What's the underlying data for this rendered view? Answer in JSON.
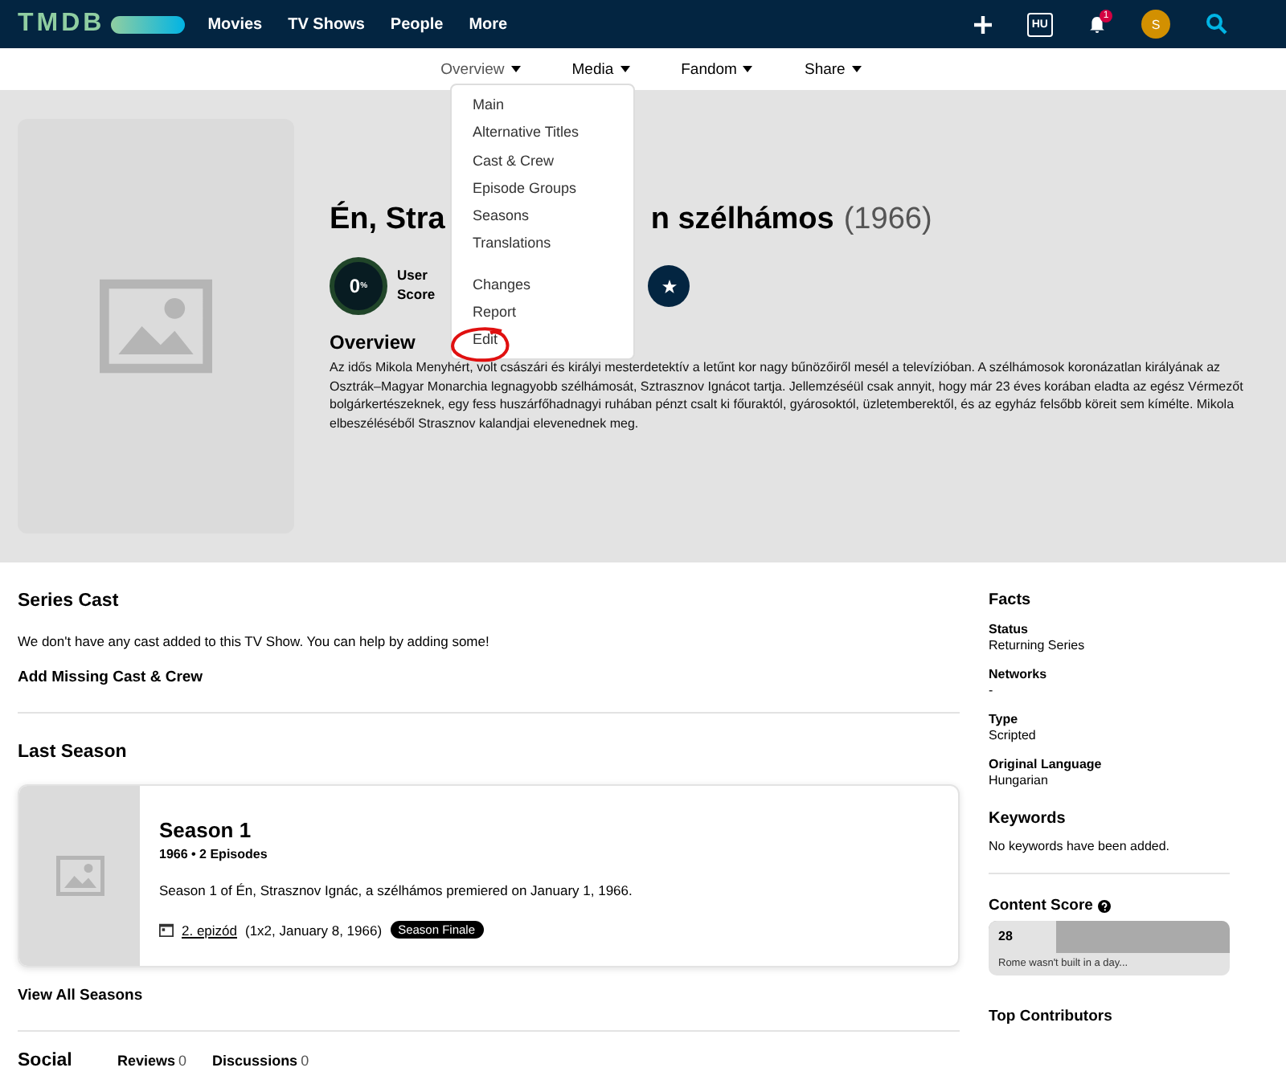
{
  "header": {
    "logo": "TMDB",
    "nav": [
      "Movies",
      "TV Shows",
      "People",
      "More"
    ],
    "language": "HU",
    "notifications": "1",
    "avatar": "S"
  },
  "subnav": [
    {
      "label": "Overview",
      "selected": true
    },
    {
      "label": "Media",
      "selected": false
    },
    {
      "label": "Fandom",
      "selected": false
    },
    {
      "label": "Share",
      "selected": false
    }
  ],
  "dropdown": {
    "groups": [
      [
        "Main",
        "Alternative Titles",
        "Cast & Crew",
        "Episode Groups",
        "Seasons",
        "Translations"
      ],
      [
        "Changes",
        "Report",
        "Edit"
      ]
    ]
  },
  "hero": {
    "title_visible_start": "Én, Stra",
    "title_visible_end": "n szélhámos",
    "year": "(1966)",
    "score": "0",
    "score_unit": "%",
    "score_label": "User Score",
    "overview_heading": "Overview",
    "overview": "Az idős Mikola Menyhért, volt császári és királyi mesterdetektív a letűnt kor nagy bűnözőiről mesél a televízióban. A szélhámosok koronázatlan királyának az Osztrák–Magyar Monarchia legnagyobb szélhámosát, Sztrasznov Ignácot tartja. Jellemzéséül csak annyit, hogy már 23 éves korában eladta az egész Vérmezőt bolgárkertészeknek, egy fess huszárfőhadnagyi ruhában pénzt csalt ki főuraktól, gyárosoktól, üzletemberektől, és az egyház felsőbb köreit sem kímélte. Mikola elbeszéléséből Strasznov kalandjai elevenednek meg."
  },
  "cast": {
    "heading": "Series Cast",
    "message": "We don't have any cast added to this TV Show. You can help by adding some!",
    "link": "Add Missing Cast & Crew"
  },
  "last_season": {
    "heading": "Last Season",
    "name": "Season 1",
    "meta": "1966 • 2 Episodes",
    "description": "Season 1 of Én, Strasznov Ignác, a szélhámos premiered on January 1, 1966.",
    "episode_link": "2. epizód",
    "episode_info": "(1x2, January 8, 1966)",
    "badge": "Season Finale",
    "view_all": "View All Seasons"
  },
  "social": {
    "heading": "Social",
    "tabs": [
      {
        "label": "Reviews",
        "count": "0"
      },
      {
        "label": "Discussions",
        "count": "0"
      }
    ]
  },
  "facts": {
    "heading": "Facts",
    "items": [
      {
        "label": "Status",
        "value": "Returning Series"
      },
      {
        "label": "Networks",
        "value": "-"
      },
      {
        "label": "Type",
        "value": "Scripted"
      },
      {
        "label": "Original Language",
        "value": "Hungarian"
      }
    ]
  },
  "keywords": {
    "heading": "Keywords",
    "message": "No keywords have been added."
  },
  "content_score": {
    "heading": "Content Score",
    "score": "28",
    "level": 0.28,
    "message": "Rome wasn't built in a day..."
  },
  "top_contributors": {
    "heading": "Top Contributors"
  }
}
